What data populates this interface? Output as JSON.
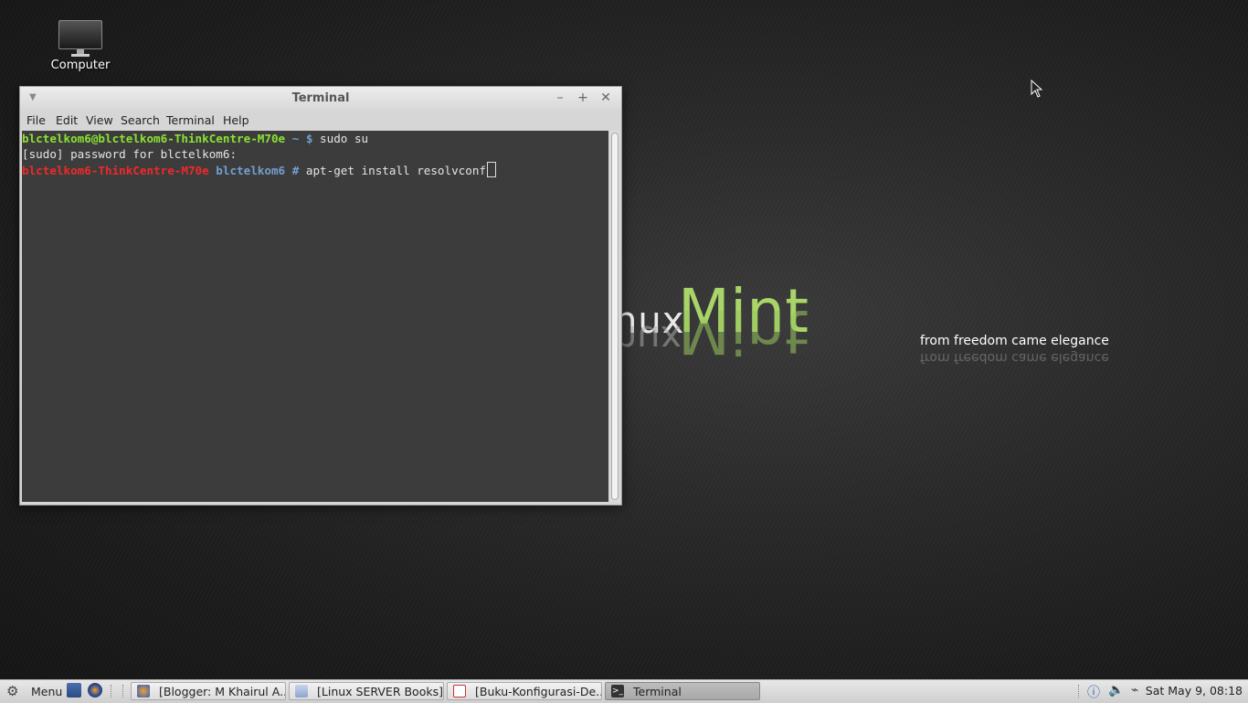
{
  "desktop": {
    "icon_label": "Computer",
    "brand_linux": "Linux",
    "brand_linux_visible": "nux",
    "brand_mint": "Mint",
    "tagline": "from freedom came elegance"
  },
  "terminal": {
    "title": "Terminal",
    "menu": [
      "File",
      "Edit",
      "View",
      "Search",
      "Terminal",
      "Help"
    ],
    "lines": {
      "l1_prompt": "blctelkom6@blctelkom6-ThinkCentre-M70e",
      "l1_tilde": " ~ $ ",
      "l1_cmd": "sudo su",
      "l2_text": "[sudo] password for blctelkom6:",
      "l3_host": "blctelkom6-ThinkCentre-M70e",
      "l3_user": " blctelkom6 # ",
      "l3_cmd": "apt-get install resolvconf"
    }
  },
  "taskbar": {
    "menu_label": "Menu",
    "tasks": [
      {
        "label": "[Blogger: M Khairul A..."
      },
      {
        "label": "[Linux SERVER Books]"
      },
      {
        "label": "[Buku-Konfigurasi-De..."
      },
      {
        "label": "Terminal"
      }
    ],
    "clock": "Sat May  9, 08:18"
  },
  "colors": {
    "prompt_green": "#8ae234",
    "prompt_blue": "#729fcf",
    "root_red": "#ef2929",
    "mint_green": "#a8d468"
  }
}
